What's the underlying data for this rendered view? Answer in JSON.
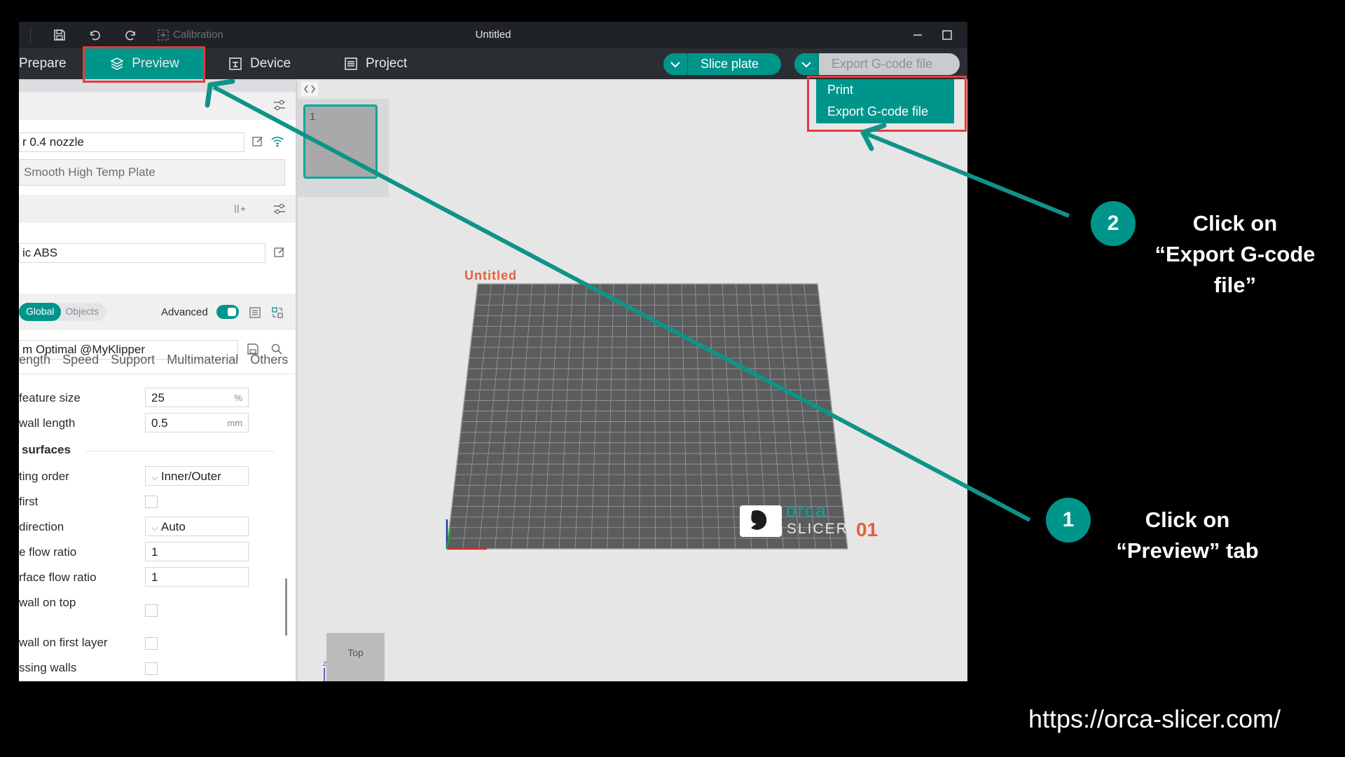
{
  "window": {
    "title": "Untitled",
    "calibration_label": "Calibration"
  },
  "tabs": [
    {
      "label": "Prepare"
    },
    {
      "label": "Preview"
    },
    {
      "label": "Device"
    },
    {
      "label": "Project"
    }
  ],
  "actions": {
    "slice_plate": "Slice plate",
    "export_gcode": "Export G-code file"
  },
  "dropdown": {
    "items": [
      "Print",
      "Export G-code file"
    ]
  },
  "sidebar": {
    "printer_value": "r 0.4 nozzle",
    "plate_value": "Smooth High Temp Plate",
    "filament_value": "ic ABS",
    "mode": {
      "global": "Global",
      "objects": "Objects",
      "advanced": "Advanced"
    },
    "process_value": "m Optimal @MyKlipper",
    "process_tabs": [
      "ength",
      "Speed",
      "Support",
      "Multimaterial",
      "Others"
    ],
    "rows": [
      {
        "label": "feature size",
        "value": "25",
        "unit": "%"
      },
      {
        "label": "wall length",
        "value": "0.5",
        "unit": "mm"
      }
    ],
    "section_heading": "surfaces",
    "rows2": [
      {
        "label": "ting order",
        "value": "Inner/Outer"
      },
      {
        "label": "first"
      },
      {
        "label": "direction",
        "value": "Auto"
      },
      {
        "label": "e flow ratio",
        "value": "1"
      },
      {
        "label": "rface flow ratio",
        "value": "1"
      },
      {
        "label": "wall on top"
      },
      {
        "label": "wall on first layer"
      },
      {
        "label": "ssing walls"
      }
    ]
  },
  "viewport": {
    "plate_thumb_number": "1",
    "plate_name": "Untitled",
    "plate_number": "01",
    "logo_top": "orca",
    "logo_bottom": "slicer",
    "view_cube_label": "Top",
    "axis_label": "z",
    "bed_color": "#5b5c5d",
    "grid_color": "#9a9c9e"
  },
  "annotations": {
    "step1_number": "1",
    "step1_line1": "Click on",
    "step1_line2": "“Preview” tab",
    "step2_number": "2",
    "step2_line1": "Click on",
    "step2_line2": "“Export G-code",
    "step2_line3": "file”",
    "url": "https://orca-slicer.com/"
  },
  "colors": {
    "accent": "#00958b",
    "highlight": "#e8383d",
    "plate_text": "#e4603a"
  }
}
